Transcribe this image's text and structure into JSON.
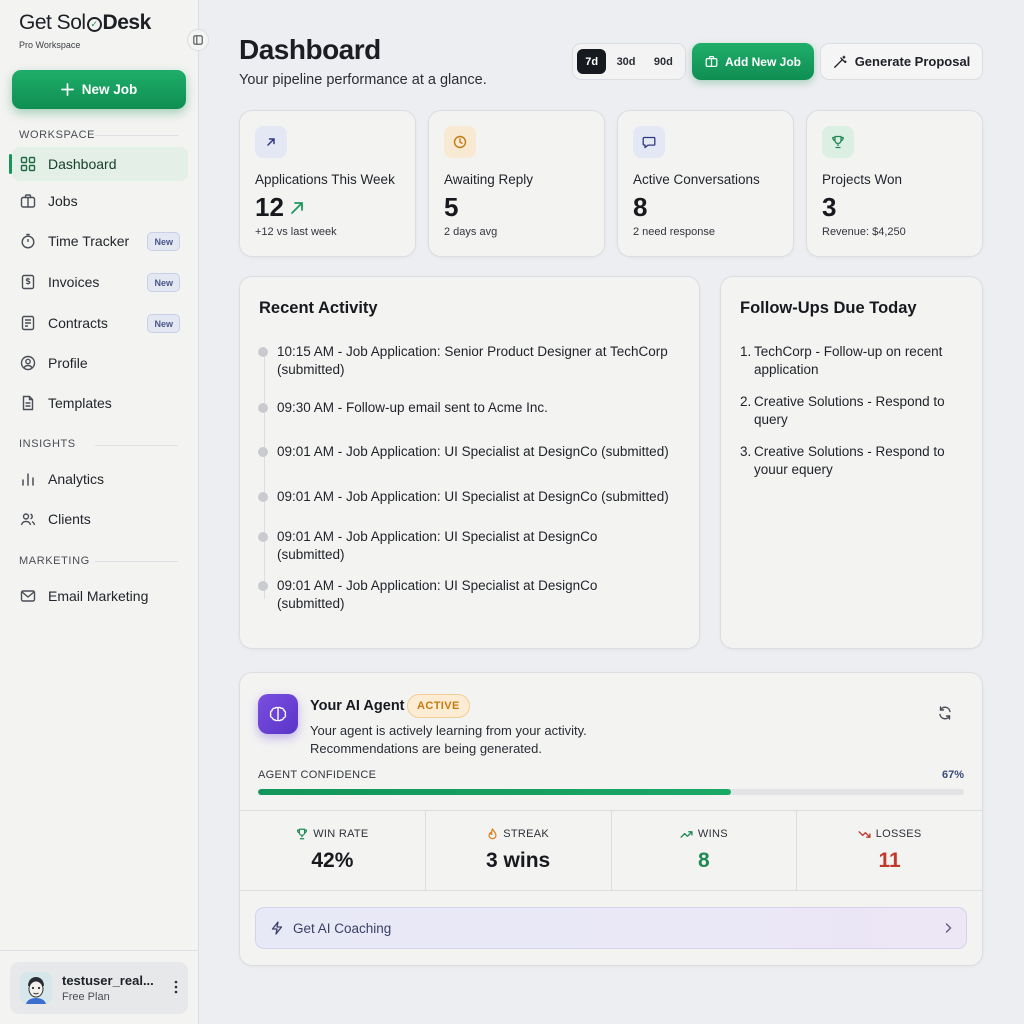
{
  "brand": {
    "name_pre": "Get Sol",
    "name_post": "Desk",
    "check_glyph": "✓",
    "subtitle": "Pro Workspace"
  },
  "sidebar": {
    "new_job_label": "New Job",
    "sections": {
      "workspace": "WORKSPACE",
      "insights": "INSIGHTS",
      "marketing": "MARKETING"
    },
    "items": [
      {
        "label": "Dashboard",
        "icon": "grid-icon",
        "active": true
      },
      {
        "label": "Jobs",
        "icon": "briefcase-icon"
      },
      {
        "label": "Time Tracker",
        "icon": "stopwatch-icon",
        "badge": "New"
      },
      {
        "label": "Invoices",
        "icon": "invoice-icon",
        "badge": "New"
      },
      {
        "label": "Contracts",
        "icon": "contract-icon",
        "badge": "New"
      },
      {
        "label": "Profile",
        "icon": "user-circle-icon"
      },
      {
        "label": "Templates",
        "icon": "document-icon"
      },
      {
        "label": "Analytics",
        "icon": "bar-chart-icon"
      },
      {
        "label": "Clients",
        "icon": "users-icon"
      },
      {
        "label": "Email Marketing",
        "icon": "mail-icon"
      }
    ],
    "user": {
      "name": "testuser_real...",
      "plan": "Free Plan"
    }
  },
  "header": {
    "title": "Dashboard",
    "subtitle": "Your pipeline performance at a glance.",
    "ranges": [
      "7d",
      "30d",
      "90d"
    ],
    "selected_range": "7d",
    "add_job_label": "Add New Job",
    "proposal_label": "Generate Proposal"
  },
  "stats": [
    {
      "label": "Applications This Week",
      "value": "12",
      "note": "+12 vs last week",
      "icon": "arrow-up-right-icon",
      "accent": "#4a57a8"
    },
    {
      "label": "Awaiting Reply",
      "value": "5",
      "note": "2 days avg",
      "icon": "clock-icon",
      "accent": "#c88a1a"
    },
    {
      "label": "Active Conversations",
      "value": "8",
      "note": "2 need response",
      "icon": "chat-icon",
      "accent": "#4a57a8"
    },
    {
      "label": "Projects Won",
      "value": "3",
      "note": "Revenue: $4,250",
      "icon": "trophy-icon",
      "accent": "#1f8a55"
    }
  ],
  "activity": {
    "title": "Recent Activity",
    "items": [
      "10:15 AM - Job Application: Senior Product Designer at TechCorp (submitted)",
      "09:30 AM - Follow-up email sent to Acme Inc.",
      "09:01 AM - Job Application: UI Specialist at DesignCo (submitted)",
      "09:01 AM - Job Application: UI Specialist at DesignCo (submitted)",
      "09:01 AM - Job Application: UI Specialist at DesignCo (submitted)",
      "09:01 AM - Job Application: UI Specialist at DesignCo (submitted)"
    ]
  },
  "followups": {
    "title": "Follow-Ups Due Today",
    "items": [
      "TechCorp - Follow-up on recent application",
      "Creative Solutions - Respond to query",
      "Creative Solutions - Respond to youur equery"
    ]
  },
  "agent": {
    "title": "Your AI Agent",
    "badge": "ACTIVE",
    "description_line1": "Your agent is actively learning from your activity.",
    "description_line2": "Recommendations are being generated.",
    "confidence_label": "AGENT CONFIDENCE",
    "confidence_text": "67%",
    "confidence_value": 0.67,
    "metrics": [
      {
        "label": "WIN RATE",
        "value": "42%",
        "icon": "trophy-icon",
        "color": "#17191e",
        "icon_color": "#1f8a55"
      },
      {
        "label": "STREAK",
        "value": "3 wins",
        "icon": "flame-icon",
        "color": "#17191e",
        "icon_color": "#e07a1a"
      },
      {
        "label": "WINS",
        "value": "8",
        "icon": "trend-up-icon",
        "color": "#1f8a55",
        "icon_color": "#1f8a55"
      },
      {
        "label": "LOSSES",
        "value": "11",
        "icon": "trend-down-icon",
        "color": "#c0392b",
        "icon_color": "#c0392b"
      }
    ],
    "coaching_label": "Get AI Coaching"
  },
  "colors": {
    "brand_green": "#17945a",
    "accent_purple": "#6a40d6",
    "loss_red": "#c0392b"
  }
}
